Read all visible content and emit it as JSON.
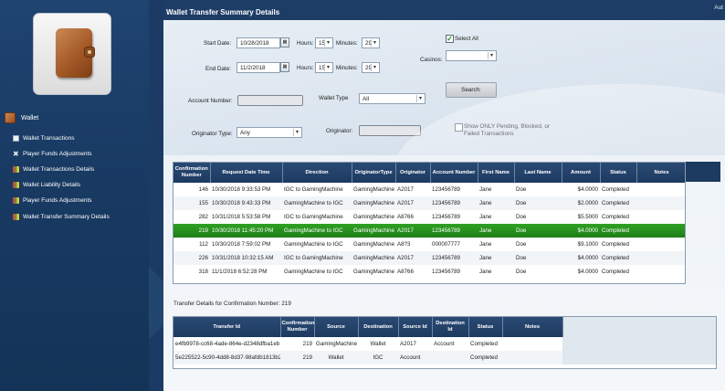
{
  "header": {
    "title": "Wallet Transfer Summary Details",
    "user_abbrev": "Aut"
  },
  "sidebar": {
    "section_label": "Wallet",
    "items": [
      {
        "label": "Wallet Transactions",
        "icon": "document-icon"
      },
      {
        "label": "Player Funds Adjustments",
        "icon": "tools-icon"
      },
      {
        "label": "Wallet Transactions Details",
        "icon": "report-icon"
      },
      {
        "label": "Wallet Liability Details",
        "icon": "report-icon"
      },
      {
        "label": "Player Funds Adjustments",
        "icon": "report-icon"
      },
      {
        "label": "Wallet Transfer Summary Details",
        "icon": "report-icon"
      }
    ]
  },
  "filters": {
    "start_date_label": "Start Date:",
    "start_date": "10/28/2018",
    "end_date_label": "End Date:",
    "end_date": "11/2/2018",
    "hours_label": "Hours:",
    "minutes_label": "Minutes:",
    "start_hours": "15",
    "start_minutes": "29",
    "end_hours": "15",
    "end_minutes": "29",
    "select_all_label": "Select All",
    "select_all_checked": true,
    "casinos_label": "Casinos:",
    "casinos_value": "",
    "account_number_label": "Account Number:",
    "account_number": "",
    "wallet_type_label": "Wallet Type",
    "wallet_type": "All",
    "search_label": "Search:",
    "originator_type_label": "Originator Type:",
    "originator_type": "Any",
    "originator_label": "Originator:",
    "originator": "",
    "show_only_label": "Show ONLY Pending, Blocked, or Failed Transactions",
    "show_only_checked": false
  },
  "summary_grid": {
    "columns": [
      "Confirmation Number",
      "Request Date Time",
      "Direction",
      "OriginatorType",
      "Originator",
      "Account Number",
      "First Name",
      "Last Name",
      "Amount",
      "Status",
      "Notes"
    ],
    "rows": [
      [
        "146",
        "10/30/2018 9:33:53 PM",
        "IGC to GamingMachine",
        "GamingMachine",
        "A2017",
        "123456789",
        "Jane",
        "Doe",
        "$4.0000",
        "Completed",
        ""
      ],
      [
        "155",
        "10/30/2018 9:43:33 PM",
        "GamingMachine to IGC",
        "GamingMachine",
        "A2017",
        "123456789",
        "Jane",
        "Doe",
        "$2.0000",
        "Completed",
        ""
      ],
      [
        "282",
        "10/31/2018 5:53:58 PM",
        "IGC to GamingMachine",
        "GamingMachine",
        "A8766",
        "123456789",
        "Jane",
        "Doe",
        "$5.5000",
        "Completed",
        ""
      ],
      [
        "219",
        "10/30/2018 11:45:20 PM",
        "GamingMachine to IGC",
        "GamingMachine",
        "A2017",
        "123456789",
        "Jane",
        "Doe",
        "$4.0000",
        "Completed",
        ""
      ],
      [
        "112",
        "10/30/2018 7:59:02 PM",
        "GamingMachine to IGC",
        "GamingMachine",
        "A8?3",
        "000007777",
        "Jane",
        "Doe",
        "$9.1000",
        "Completed",
        ""
      ],
      [
        "226",
        "10/31/2018 10:32:15 AM",
        "IGC to GamingMachine",
        "GamingMachine",
        "A2017",
        "123456789",
        "Jane",
        "Doe",
        "$4.0000",
        "Completed",
        ""
      ],
      [
        "318",
        "11/1/2018 6:52:28 PM",
        "GamingMachine to IGC",
        "GamingMachine",
        "A8766",
        "123456789",
        "Jane",
        "Doe",
        "$4.0000",
        "Completed",
        ""
      ]
    ],
    "selected_index": 3
  },
  "transfer_details": {
    "caption": "Transfer Details for Confirmation Number: 219",
    "columns": [
      "Transfer Id",
      "Confirmation Number",
      "Source",
      "Destination",
      "Source Id",
      "Destination Id",
      "Status",
      "Notes"
    ],
    "rows": [
      [
        "e4fb9978-cc68-4ade-864e-d2348dfba1eb",
        "219",
        "GamingMachine",
        "Wallet",
        "A2017",
        "Account",
        "Completed",
        ""
      ],
      [
        "5e225522-5c90-4dd8-8d37-98afdb1813b2",
        "219",
        "Wallet",
        "IGC",
        "Account",
        "",
        "Completed",
        ""
      ]
    ]
  }
}
